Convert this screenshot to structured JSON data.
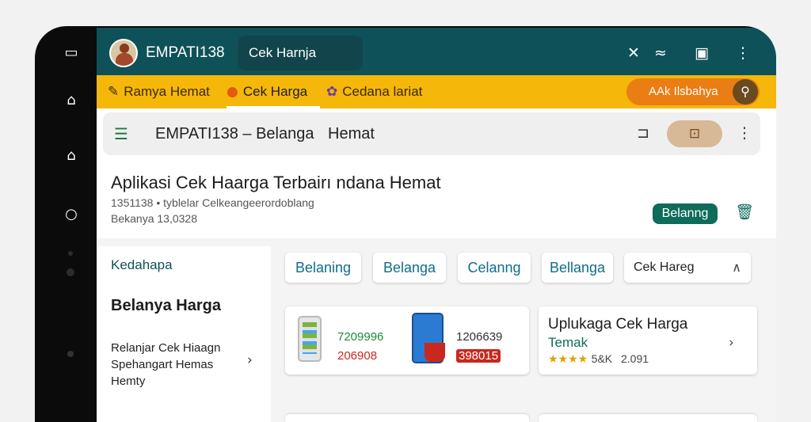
{
  "appbar": {
    "brand": "EMPATI138",
    "search_value": "Cek Harnja",
    "actions": [
      "pin-icon",
      "wifi-icon",
      "clipboard-icon",
      "more-vert-icon"
    ]
  },
  "promo": {
    "items": [
      {
        "icon": "pencil-icon",
        "label": "Ramya Hemat"
      },
      {
        "icon": "tag-icon",
        "label": "Cek Harga"
      },
      {
        "icon": "grapes-icon",
        "label": "Cedana lariat"
      }
    ],
    "button_label": "AAk Ilsbahya",
    "button_icon": "search-icon"
  },
  "toolbar": {
    "title": "EMPATI138 – Belanga",
    "subtitle": "Hemat",
    "icons": [
      "bookmark-icon",
      "cart-icon",
      "more-vert-icon"
    ]
  },
  "hero": {
    "title": "Aplikasi Cek Haarga Terbairı ndana Hemat",
    "meta_line1": "1351138 • tyblelar Celkeangeerordoblang",
    "meta_line2": "Bekanya 13,0328",
    "chip": "Belanng",
    "trash_icon": "trash-icon"
  },
  "sidebar": {
    "label": "Kedahapa",
    "heading": "Belanya Harga",
    "item": "Relanjar Cek Hiaagn Spehangart Hemas Hemty"
  },
  "filters": {
    "chips": [
      "Belaning",
      "Belanga",
      "Celanng",
      "Bellanga"
    ],
    "dropdown": "Cek Hareg"
  },
  "product_card": {
    "price1_green": "7209996",
    "price1_red": "206908",
    "price2_dark": "1206639",
    "price2_tag": "398015"
  },
  "info_card": {
    "title": "Uplukaga Cek Harga",
    "subtitle": "Temak",
    "stars": "★★★★",
    "rating": "5&K",
    "count": "2.091"
  },
  "colors": {
    "appbar": "#0f5158",
    "promo": "#f5b70a",
    "accent_orange": "#ea7d14",
    "accent_teal": "#0f6b5a"
  }
}
